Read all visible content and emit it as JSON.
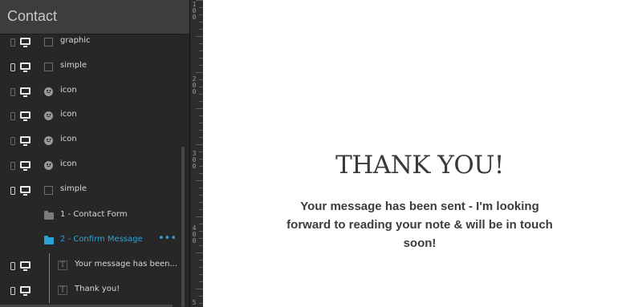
{
  "panel": {
    "title": "Contact",
    "layers": [
      {
        "label": "graphic",
        "icon": "square-icon"
      },
      {
        "label": "simple",
        "icon": "square-icon"
      },
      {
        "label": "icon",
        "icon": "smiley-icon"
      },
      {
        "label": "icon",
        "icon": "smiley-icon"
      },
      {
        "label": "icon",
        "icon": "smiley-icon"
      },
      {
        "label": "icon",
        "icon": "smiley-icon"
      },
      {
        "label": "simple",
        "icon": "square-icon"
      },
      {
        "label": "1 - Contact Form",
        "icon": "folder-icon"
      },
      {
        "label": "2 - Confirm Message",
        "icon": "folder-open-icon",
        "more": "•••"
      },
      {
        "label": "Your message has been...",
        "icon": "text-icon",
        "glyph": "T"
      },
      {
        "label": "Thank you!",
        "icon": "text-icon",
        "glyph": "T"
      }
    ]
  },
  "ruler": {
    "labels": [
      "1\n0\n0",
      "2\n0\n0",
      "3\n0\n0",
      "4\n0\n0",
      "5"
    ]
  },
  "canvas": {
    "heading": "THANK YOU!",
    "message": "Your message has been sent - I'm looking forward to reading your note & will be in touch soon!"
  },
  "colors": {
    "accent": "#2aa3d8",
    "panel_bg": "#272727",
    "header_bg": "#3d3d3d"
  }
}
